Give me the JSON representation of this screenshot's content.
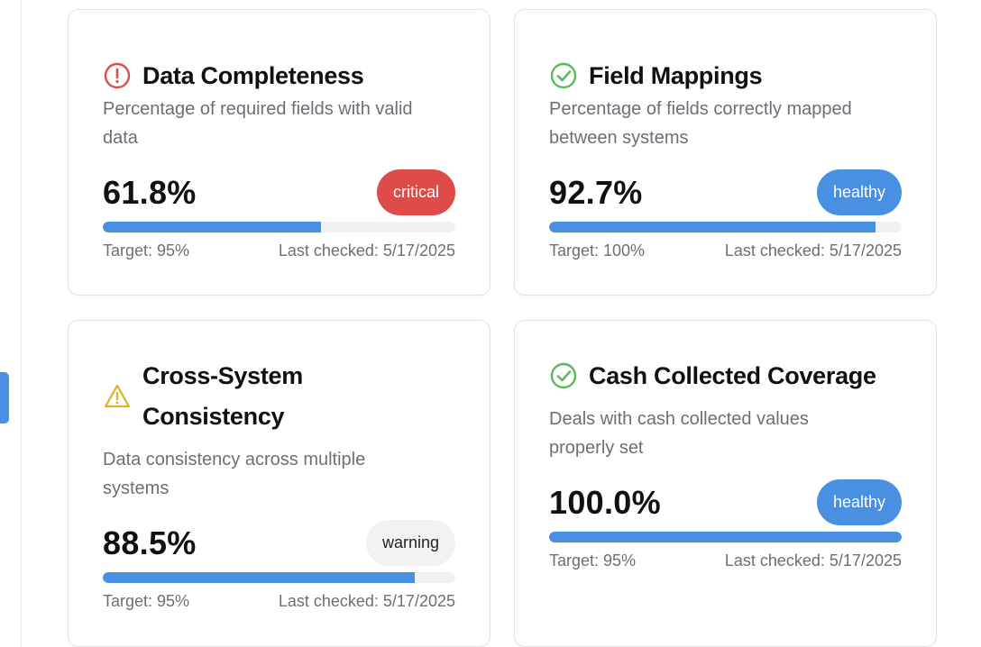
{
  "cards": [
    {
      "title": "Data Completeness",
      "icon": "alert-circle-icon",
      "description": "Percentage of required fields with valid data",
      "value": "61.8%",
      "progress": 0.618,
      "status": "critical",
      "target": "Target: 95%",
      "last_checked": "Last checked: 5/17/2025"
    },
    {
      "title": "Field Mappings",
      "icon": "check-circle-icon",
      "description": "Percentage of fields correctly mapped between systems",
      "value": "92.7%",
      "progress": 0.927,
      "status": "healthy",
      "target": "Target: 100%",
      "last_checked": "Last checked: 5/17/2025"
    },
    {
      "title": "Cross-System Consistency",
      "icon": "warning-triangle-icon",
      "description": "Data consistency across multiple systems",
      "value": "88.5%",
      "progress": 0.885,
      "status": "warning",
      "target": "Target: 95%",
      "last_checked": "Last checked: 5/17/2025"
    },
    {
      "title": "Cash Collected Coverage",
      "icon": "check-circle-icon",
      "description": "Deals with cash collected values properly set",
      "value": "100.0%",
      "progress": 1.0,
      "status": "healthy",
      "target": "Target: 95%",
      "last_checked": "Last checked: 5/17/2025"
    }
  ],
  "colors": {
    "accent": "#4a90e2",
    "critical": "#de4c4a",
    "healthy": "#5cb85c",
    "warning": "#e0b42c"
  }
}
